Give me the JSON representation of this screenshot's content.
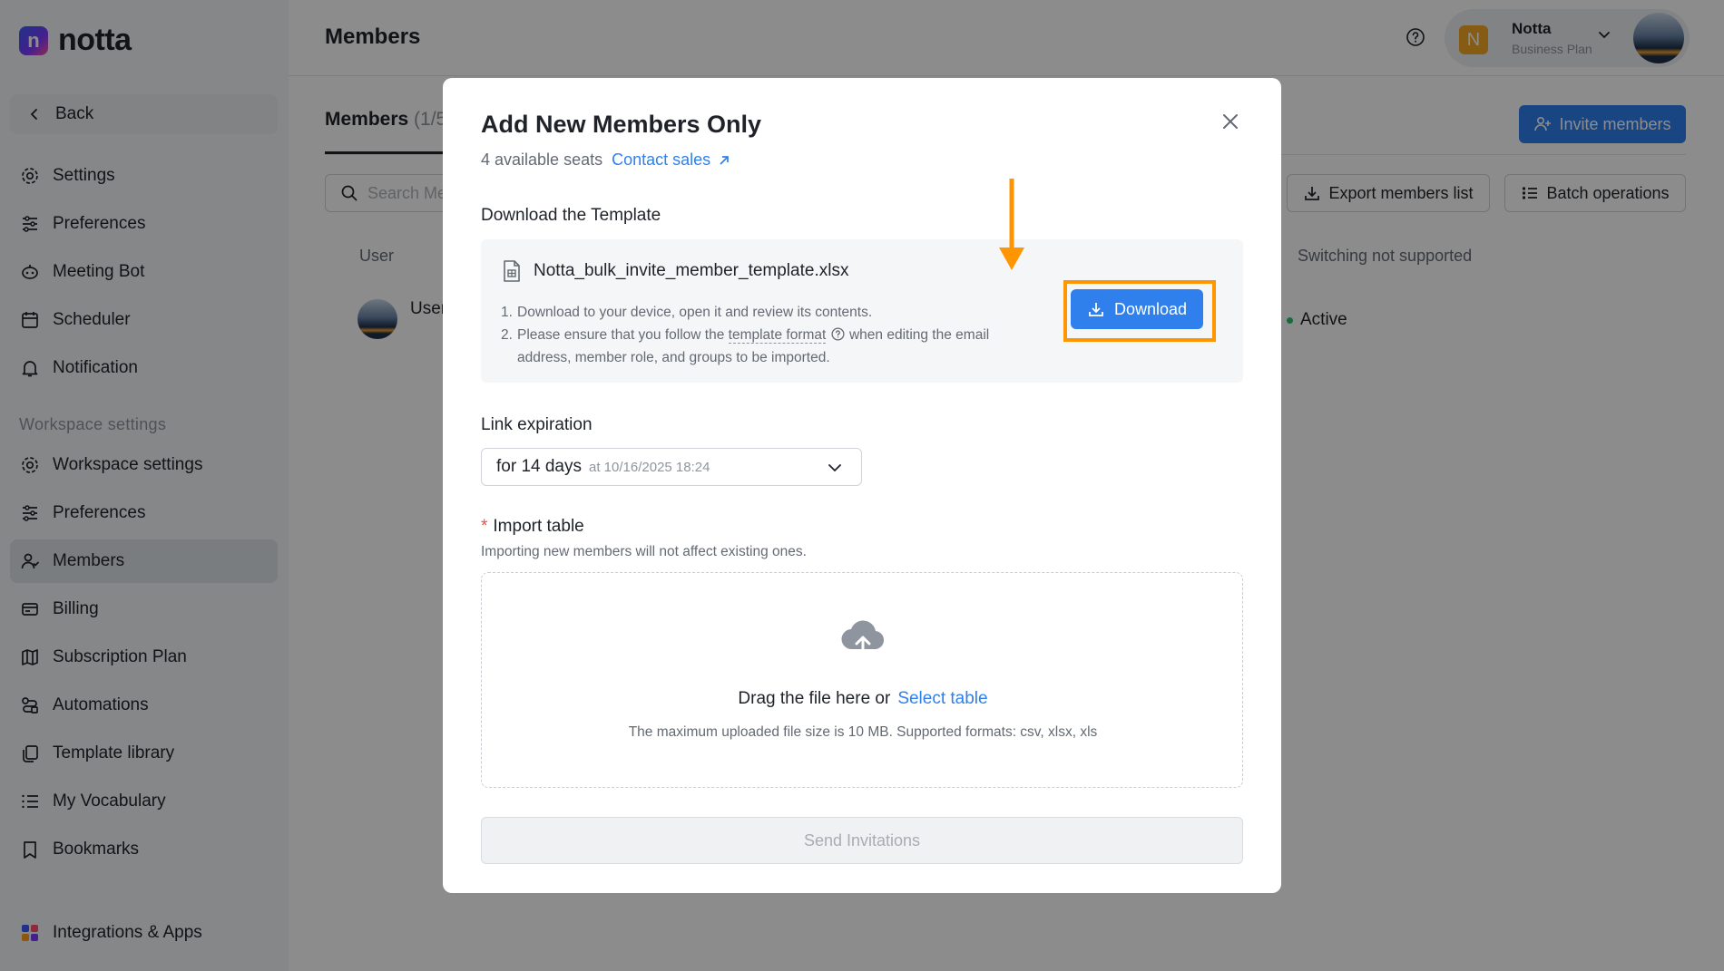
{
  "app": {
    "name": "notta",
    "logo_letter": "n"
  },
  "sidebar": {
    "back_label": "Back",
    "items": [
      {
        "label": "Settings",
        "icon": "gear-icon"
      },
      {
        "label": "Preferences",
        "icon": "sliders-icon"
      },
      {
        "label": "Meeting Bot",
        "icon": "bot-icon"
      },
      {
        "label": "Scheduler",
        "icon": "calendar-icon"
      },
      {
        "label": "Notification",
        "icon": "bell-icon"
      }
    ],
    "section_title": "Workspace settings",
    "workspace_items": [
      {
        "label": "Workspace settings",
        "icon": "gear-icon"
      },
      {
        "label": "Preferences",
        "icon": "sliders-icon"
      },
      {
        "label": "Members",
        "icon": "users-icon",
        "active": true
      },
      {
        "label": "Billing",
        "icon": "card-icon"
      },
      {
        "label": "Subscription Plan",
        "icon": "map-icon"
      },
      {
        "label": "Automations",
        "icon": "automation-icon"
      },
      {
        "label": "Template library",
        "icon": "template-icon"
      },
      {
        "label": "My Vocabulary",
        "icon": "list-icon"
      },
      {
        "label": "Bookmarks",
        "icon": "bookmark-icon"
      }
    ],
    "integrations_label": "Integrations & Apps"
  },
  "header": {
    "title": "Members",
    "account": {
      "avatar_letter": "N",
      "name": "Notta",
      "plan": "Business Plan"
    }
  },
  "members_page": {
    "tab_label": "Members",
    "tab_count": "(1/5",
    "invite_button": "Invite members",
    "search_placeholder": "Search Me",
    "export_button": "Export members list",
    "batch_button": "Batch operations",
    "col_user": "User",
    "col_switch": "Switching not supported",
    "row": {
      "user": "User",
      "status": "Active"
    }
  },
  "modal": {
    "title": "Add New Members Only",
    "seats_text": "4 available seats",
    "contact_sales": "Contact sales",
    "download_section": "Download the Template",
    "file_name": "Notta_bulk_invite_member_template.xlsx",
    "step1_num": "1.",
    "step1": "Download to your device, open it and review its contents.",
    "step2_num": "2.",
    "step2_before": "Please ensure that you follow the",
    "step2_link": "template format",
    "step2_after": "when editing the email",
    "step2_line2": "address, member role, and groups to be imported.",
    "download_button": "Download",
    "link_expiration_label": "Link expiration",
    "expiration_value": "for 14 days",
    "expiration_sub": "at 10/16/2025 18:24",
    "required_mark": "*",
    "import_label": "Import table",
    "import_hint": "Importing new members will not affect existing ones.",
    "drop_text": "Drag the file here or",
    "select_table": "Select table",
    "drop_hint": "The maximum uploaded file size is 10 MB. Supported formats: csv, xlsx, xls",
    "send_button": "Send Invitations"
  },
  "colors": {
    "accent": "#2f80ed",
    "highlight": "#ff9500",
    "active_status": "#2ebf6e"
  }
}
